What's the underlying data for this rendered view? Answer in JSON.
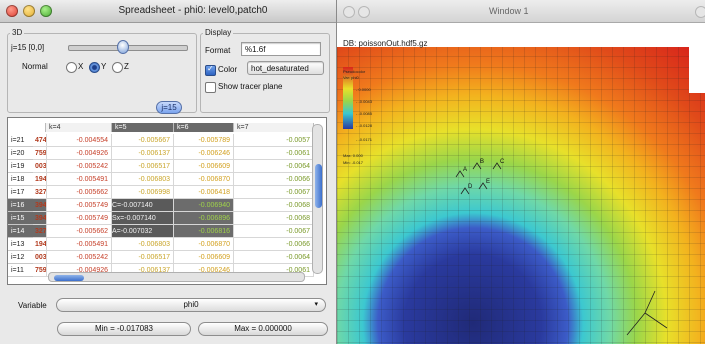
{
  "spreadsheet": {
    "title": "Spreadsheet - phi0: level0,patch0",
    "section_3d": "3D",
    "slice_label": "j=15 [0,0]",
    "normal_label": "Normal",
    "normal_options": [
      "X",
      "Y",
      "Z"
    ],
    "normal_selected": "Y",
    "display_section": "Display",
    "format_label": "Format",
    "format_value": "%1.6f",
    "color_label": "Color",
    "color_checked": true,
    "colortable_value": "hot_desaturated",
    "show_tracer_label": "Show tracer plane",
    "show_tracer_checked": false,
    "slice_tab": "j=15",
    "col_headers": [
      "k=4",
      "k=5",
      "k=6",
      "k=7"
    ],
    "row_labels": [
      "i=21",
      "i=20",
      "i=19",
      "i=18",
      "i=17",
      "i=16",
      "i=15",
      "i=14",
      "i=13",
      "i=12",
      "i=11"
    ],
    "selected_rows": [
      "i=16",
      "i=15",
      "i=14"
    ],
    "rows": [
      [
        "474",
        "-0.004554",
        "-0.005667",
        "-0.005789",
        "-0.0057"
      ],
      [
        "759",
        "-0.004926",
        "-0.006137",
        "-0.006246",
        "-0.0061"
      ],
      [
        "003",
        "-0.005242",
        "-0.006517",
        "-0.006609",
        "-0.0064"
      ],
      [
        "194",
        "-0.005491",
        "-0.006803",
        "-0.006870",
        "-0.0066"
      ],
      [
        "327",
        "-0.005662",
        "-0.006998",
        "-0.006418",
        "-0.0067"
      ],
      [
        "394",
        "-0.005749",
        "C=-0.007140",
        "-0.006940",
        "-0.0068"
      ],
      [
        "394",
        "-0.005749",
        "Sx=-0.007140",
        "-0.006896",
        "-0.0068"
      ],
      [
        "327",
        "-0.005662",
        "A=-0.007032",
        "-0.006816",
        "-0.0067"
      ],
      [
        "194",
        "-0.005491",
        "-0.006803",
        "-0.006870",
        "-0.0066"
      ],
      [
        "003",
        "-0.005242",
        "-0.006517",
        "-0.006609",
        "-0.0064"
      ],
      [
        "759",
        "-0.004926",
        "-0.006137",
        "-0.006246",
        "-0.0061"
      ]
    ],
    "variable_label": "Variable",
    "variable_value": "phi0",
    "min_label": "Min = -0.017083",
    "max_label": "Max = 0.000000"
  },
  "viz": {
    "title": "Window 1",
    "db_label": "DB: poissonOut.hdf5.gz",
    "legend_labels": [
      "Pseudocolor",
      "Var: phi0",
      "- 0.0000",
      "- -0.0043",
      "- -0.0085",
      "- -0.0128",
      "- -0.0171",
      "Max: 0.000",
      "Min: -0.017"
    ],
    "node_labels": [
      "A",
      "B",
      "C",
      "D",
      "E"
    ],
    "colors": {
      "red": "#d8261b",
      "orange": "#f07a1c",
      "yellow": "#e8e02a",
      "green": "#9ad64a",
      "cyan": "#3cc8d0",
      "blue": "#2a3a9e",
      "deep_blue": "#202a78"
    }
  }
}
